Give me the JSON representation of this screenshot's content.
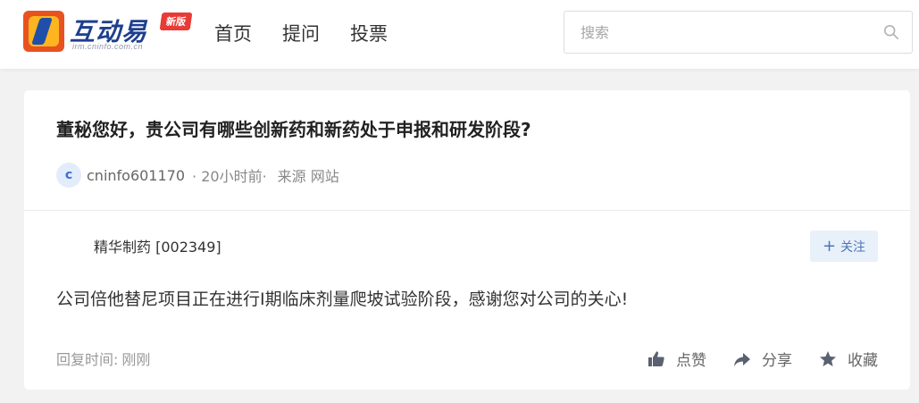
{
  "header": {
    "logo_text": "互动易",
    "logo_sub": "irm.cninfo.com.cn",
    "logo_badge": "新版",
    "nav": [
      {
        "label": "首页"
      },
      {
        "label": "提问"
      },
      {
        "label": "投票"
      }
    ],
    "search_placeholder": "搜索"
  },
  "card": {
    "question": "董秘您好，贵公司有哪些创新药和新药处于申报和研发阶段?",
    "avatar_letter": "c",
    "asker": "cninfo601170",
    "time": "· 20小时前·",
    "source": "来源 网站",
    "company": "精华制药 [002349]",
    "follow_label": "关注",
    "answer": "公司倍他替尼项目正在进行Ⅰ期临床剂量爬坡试验阶段，感谢您对公司的关心!",
    "reply_time_label": "回复时间:",
    "reply_time_value": "刚刚",
    "actions": {
      "like": "点赞",
      "share": "分享",
      "collect": "收藏"
    }
  },
  "colors": {
    "accent_blue": "#1e3f8f",
    "badge_red": "#e83a36",
    "follow_bg": "#e8f0fa",
    "follow_text": "#4a76b8",
    "page_bg": "#f2f2f2"
  },
  "icons": [
    "logo-mark",
    "search-icon",
    "plus-icon",
    "thumbs-up-icon",
    "share-icon",
    "star-icon"
  ]
}
